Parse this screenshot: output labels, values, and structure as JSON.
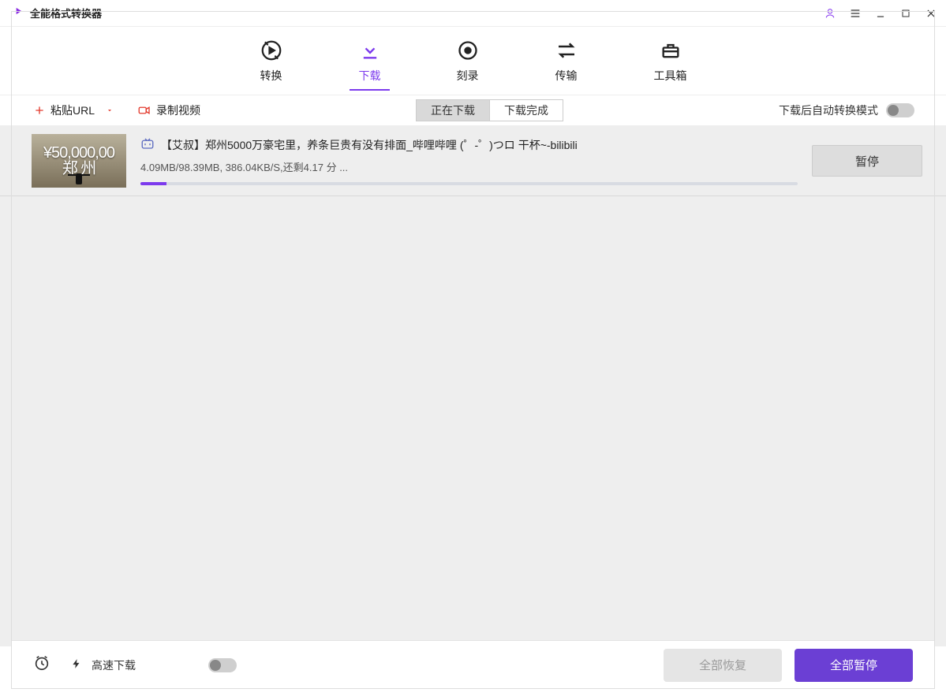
{
  "app": {
    "title": "全能格式转换器"
  },
  "nav": {
    "items": [
      {
        "label": "转换"
      },
      {
        "label": "下载"
      },
      {
        "label": "刻录"
      },
      {
        "label": "传输"
      },
      {
        "label": "工具箱"
      }
    ]
  },
  "actionbar": {
    "paste_url": "粘贴URL",
    "record_video": "录制视频",
    "seg_downloading": "正在下载",
    "seg_completed": "下载完成",
    "auto_convert_label": "下载后自动转换模式"
  },
  "downloads": {
    "items": [
      {
        "source": "bilibili",
        "thumb_caption_top": "¥50,000,00",
        "thumb_caption_bottom": "郑   州",
        "title": "【艾叔】郑州5000万豪宅里，养条巨贵有没有排面_哔哩哔哩 (゜-゜)つロ 干杯~-bilibili",
        "progress_text": "4.09MB/98.39MB, 386.04KB/S,还剩4.17 分 ...",
        "progress_percent": 4,
        "action_label": "暂停"
      }
    ]
  },
  "footer": {
    "high_speed_label": "高速下载",
    "resume_all": "全部恢复",
    "pause_all": "全部暂停"
  }
}
